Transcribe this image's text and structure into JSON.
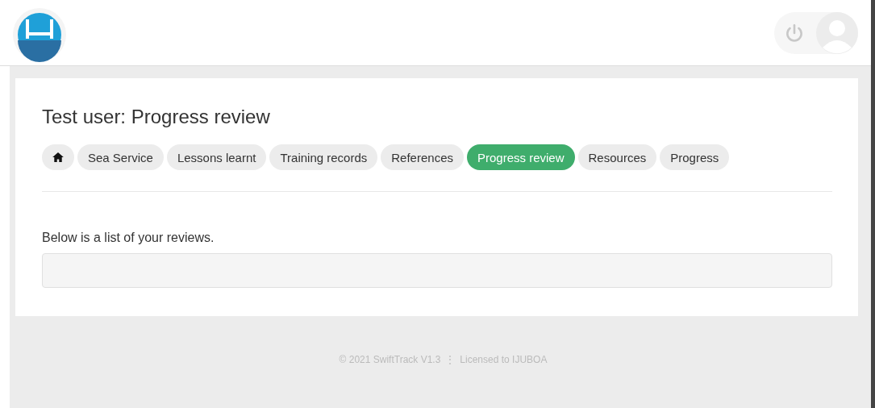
{
  "page_title": "Test user: Progress review",
  "tabs": [
    {
      "kind": "home",
      "selected": false
    },
    {
      "kind": "text",
      "label": "Sea Service",
      "selected": false
    },
    {
      "kind": "text",
      "label": "Lessons learnt",
      "selected": false
    },
    {
      "kind": "text",
      "label": "Training records",
      "selected": false
    },
    {
      "kind": "text",
      "label": "References",
      "selected": false
    },
    {
      "kind": "text",
      "label": "Progress review",
      "selected": true
    },
    {
      "kind": "text",
      "label": "Resources",
      "selected": false
    },
    {
      "kind": "text",
      "label": "Progress",
      "selected": false
    }
  ],
  "intro": "Below is a list of your reviews.",
  "footer": {
    "copyright": "© 2021 SwiftTrack V1.3",
    "separator": "⋮",
    "license": "Licensed to IJUBOA"
  }
}
